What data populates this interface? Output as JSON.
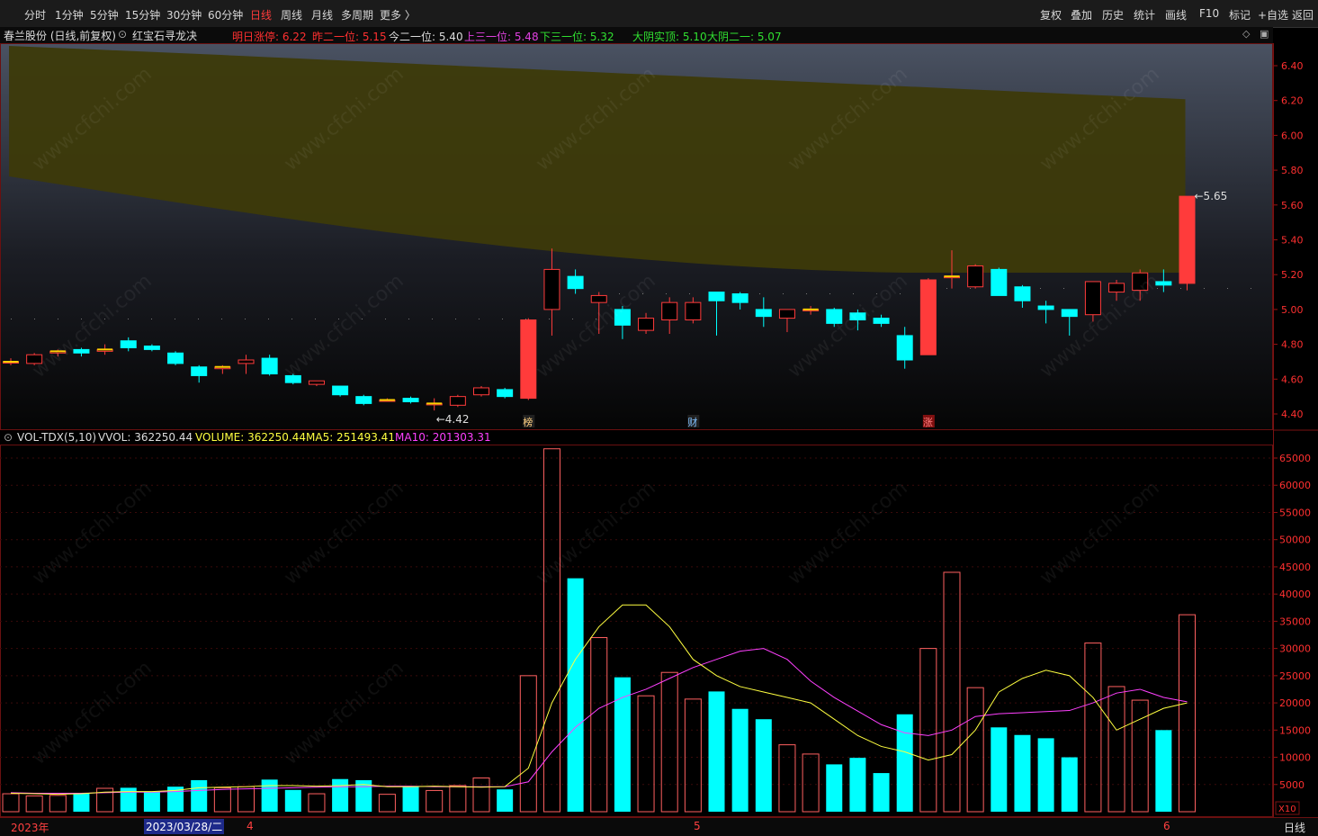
{
  "toolbar": {
    "periods": [
      "分时",
      "1分钟",
      "5分钟",
      "15分钟",
      "30分钟",
      "60分钟",
      "日线",
      "周线",
      "月线",
      "多周期",
      "更多 〉"
    ],
    "active": "日线",
    "right": [
      "复权",
      "叠加",
      "历史",
      "统计",
      "画线",
      "F10",
      "标记",
      "+自选",
      "返回"
    ]
  },
  "info": {
    "stock": "春兰股份 (日线,前复权)",
    "indicator": "红宝石寻龙决",
    "items": [
      {
        "label": "明日涨停: ",
        "value": "6.22",
        "color": "#ff3030"
      },
      {
        "label": "昨二一位: ",
        "value": "5.15",
        "color": "#ff3030"
      },
      {
        "label": "今二一位: ",
        "value": "5.40",
        "color": "#dddddd"
      },
      {
        "label": "上三一位: ",
        "value": "5.48",
        "color": "#e040e0"
      },
      {
        "label": "下三一位: ",
        "value": "5.32",
        "color": "#30e030"
      },
      {
        "label": "大阴实顶: ",
        "value": "5.10",
        "color": "#30e030"
      },
      {
        "label": "大阴二一: ",
        "value": "5.07",
        "color": "#30e030"
      }
    ]
  },
  "vol_info": {
    "name": "VOL-TDX(5,10)",
    "vvol": "VVOL: 362250.44",
    "volume": "VOLUME: 362250.44",
    "ma5": "MA5: 251493.41",
    "ma10": "MA10: 201303.31"
  },
  "price_axis": [
    "6.40",
    "6.20",
    "6.00",
    "5.80",
    "5.60",
    "5.40",
    "5.20",
    "5.00",
    "4.80",
    "4.60",
    "4.40"
  ],
  "vol_axis": [
    "65000",
    "60000",
    "55000",
    "50000",
    "45000",
    "40000",
    "35000",
    "30000",
    "25000",
    "20000",
    "15000",
    "10000",
    "5000"
  ],
  "vol_multiplier": "X10",
  "period_label": "日线",
  "dates": {
    "year": "2023年",
    "selected": "2023/03/28/二",
    "m4": "4",
    "m5": "5",
    "m6": "6"
  },
  "markers": [
    "榜",
    "财",
    "涨"
  ],
  "annotations": {
    "low": "4.42",
    "high": "5.65"
  },
  "watermark": "www.cfchi.com",
  "colors": {
    "up": "#ff3b3b",
    "down": "#00ffff",
    "band": "#3d3a0a",
    "ma5": "#ffff40",
    "ma10": "#ff40ff"
  },
  "chart_data": {
    "type": "candlestick",
    "ohlc": [
      [
        4.7,
        4.72,
        4.68,
        4.7
      ],
      [
        4.69,
        4.75,
        4.68,
        4.74
      ],
      [
        4.75,
        4.77,
        4.73,
        4.76
      ],
      [
        4.77,
        4.78,
        4.73,
        4.75
      ],
      [
        4.76,
        4.8,
        4.74,
        4.77
      ],
      [
        4.82,
        4.84,
        4.76,
        4.78
      ],
      [
        4.79,
        4.8,
        4.76,
        4.77
      ],
      [
        4.75,
        4.76,
        4.68,
        4.69
      ],
      [
        4.67,
        4.68,
        4.58,
        4.62
      ],
      [
        4.66,
        4.68,
        4.63,
        4.67
      ],
      [
        4.69,
        4.74,
        4.63,
        4.71
      ],
      [
        4.72,
        4.74,
        4.62,
        4.63
      ],
      [
        4.62,
        4.63,
        4.57,
        4.58
      ],
      [
        4.57,
        4.59,
        4.56,
        4.59
      ],
      [
        4.56,
        4.56,
        4.5,
        4.51
      ],
      [
        4.5,
        4.51,
        4.45,
        4.46
      ],
      [
        4.48,
        4.49,
        4.47,
        4.48
      ],
      [
        4.49,
        4.5,
        4.46,
        4.47
      ],
      [
        4.46,
        4.49,
        4.42,
        4.46
      ],
      [
        4.45,
        4.51,
        4.44,
        4.5
      ],
      [
        4.51,
        4.56,
        4.5,
        4.55
      ],
      [
        4.54,
        4.55,
        4.49,
        4.5
      ],
      [
        4.49,
        4.95,
        4.48,
        4.94
      ],
      [
        5.0,
        5.35,
        4.85,
        5.23
      ],
      [
        5.19,
        5.23,
        5.09,
        5.12
      ],
      [
        5.04,
        5.1,
        4.86,
        5.08
      ],
      [
        5.0,
        5.02,
        4.83,
        4.91
      ],
      [
        4.88,
        4.98,
        4.86,
        4.95
      ],
      [
        4.94,
        5.07,
        4.86,
        5.04
      ],
      [
        4.94,
        5.07,
        4.92,
        5.04
      ],
      [
        5.1,
        5.1,
        4.85,
        5.05
      ],
      [
        5.09,
        5.1,
        5.0,
        5.04
      ],
      [
        5.0,
        5.07,
        4.9,
        4.96
      ],
      [
        4.95,
        5.0,
        4.87,
        5.0
      ],
      [
        5.0,
        5.02,
        4.97,
        5.0
      ],
      [
        5.0,
        5.01,
        4.9,
        4.92
      ],
      [
        4.98,
        5.0,
        4.88,
        4.94
      ],
      [
        4.95,
        4.97,
        4.9,
        4.92
      ],
      [
        4.85,
        4.9,
        4.66,
        4.71
      ],
      [
        4.74,
        5.18,
        4.74,
        5.17
      ],
      [
        5.19,
        5.34,
        5.12,
        5.19
      ],
      [
        5.13,
        5.26,
        5.12,
        5.25
      ],
      [
        5.23,
        5.24,
        5.08,
        5.08
      ],
      [
        5.13,
        5.14,
        5.01,
        5.05
      ],
      [
        5.02,
        5.05,
        4.92,
        5.0
      ],
      [
        5.0,
        5.0,
        4.85,
        4.96
      ],
      [
        4.97,
        5.16,
        4.93,
        5.16
      ],
      [
        5.1,
        5.17,
        5.05,
        5.15
      ],
      [
        5.11,
        5.23,
        5.05,
        5.21
      ],
      [
        5.16,
        5.23,
        5.1,
        5.14
      ],
      [
        5.15,
        5.65,
        5.11,
        5.65
      ]
    ],
    "volume": [
      3300,
      2900,
      3000,
      3300,
      4300,
      4400,
      3600,
      4600,
      5800,
      4400,
      4600,
      5900,
      4000,
      3300,
      6000,
      5800,
      3200,
      4600,
      3900,
      4800,
      6200,
      4100,
      25000,
      66700,
      42900,
      32000,
      24700,
      21300,
      25600,
      20700,
      22100,
      18900,
      17000,
      12300,
      10600,
      8700,
      9900,
      7100,
      17900,
      30000,
      44000,
      22800,
      15500,
      14100,
      13500,
      10000,
      31000,
      23000,
      20500,
      15000,
      36200
    ],
    "ma5": [
      3400,
      3300,
      3200,
      3300,
      3600,
      3700,
      3700,
      3900,
      4400,
      4500,
      4600,
      4800,
      4800,
      4700,
      4800,
      5000,
      4600,
      4600,
      4700,
      4600,
      4500,
      4600,
      8000,
      20000,
      28000,
      34000,
      38000,
      38000,
      34000,
      28000,
      25000,
      23000,
      22000,
      21000,
      20000,
      17000,
      14000,
      12000,
      11000,
      9500,
      10500,
      15000,
      22000,
      24500,
      26000,
      25000,
      21000,
      15000,
      17000,
      19000,
      20000,
      25000
    ],
    "ma10": [
      3500,
      3400,
      3400,
      3400,
      3500,
      3600,
      3600,
      3700,
      3900,
      4100,
      4200,
      4300,
      4400,
      4500,
      4600,
      4600,
      4700,
      4700,
      4600,
      4600,
      4600,
      4600,
      5500,
      11000,
      15500,
      19000,
      21000,
      22500,
      24500,
      26500,
      28000,
      29500,
      30000,
      28000,
      24000,
      21000,
      18500,
      16000,
      14500,
      14000,
      15000,
      17500,
      18000,
      18200,
      18400,
      18600,
      20000,
      21800,
      22500,
      21000,
      20200
    ]
  }
}
